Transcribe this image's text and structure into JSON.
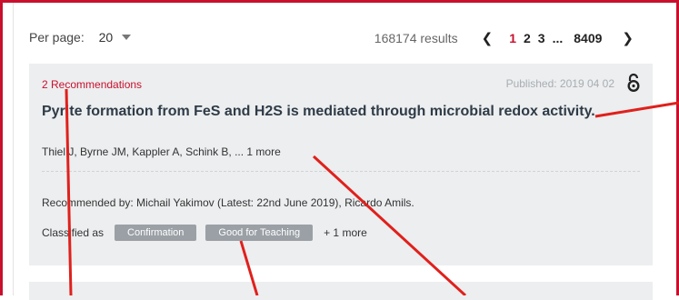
{
  "toolbar": {
    "per_page_label": "Per page:",
    "per_page_value": "20",
    "results_text": "168174 results",
    "pages": [
      "1",
      "2",
      "3"
    ],
    "active_page": "1",
    "ellipsis": "...",
    "last_page": "8409",
    "prev_icon": "chevron-left-icon",
    "next_icon": "chevron-right-icon"
  },
  "article": {
    "recommendations": "2 Recommendations",
    "published": "Published: 2019 04 02",
    "open_access_icon": "open-access-lock-icon",
    "title": "Pyrite formation from FeS and H2S is mediated through microbial redox activity.",
    "authors": "Thiel J, Byrne JM, Kappler A, Schink B, ... 1 more",
    "recommended_by": "Recommended by: Michail Yakimov (Latest: 22nd June 2019), Ricardo Amils.",
    "classified_label": "Classified as",
    "classifications": [
      "Confirmation",
      "Good for Teaching"
    ],
    "more_classifications": "+ 1 more"
  },
  "colors": {
    "accent": "#c8102e",
    "card_bg": "#eceeef",
    "badge_bg": "#9aa0a6"
  }
}
